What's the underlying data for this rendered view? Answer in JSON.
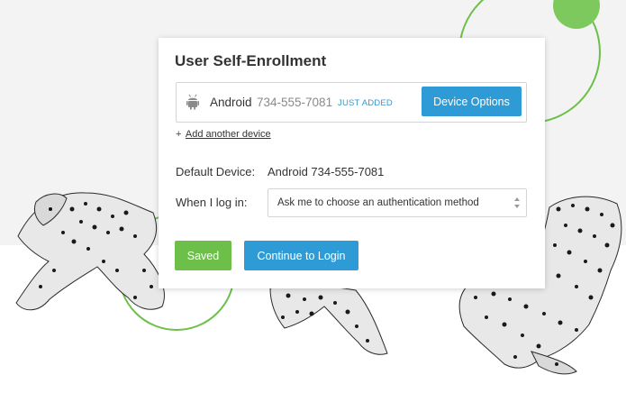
{
  "colors": {
    "accent_blue": "#2e9bd6",
    "accent_green": "#6cc04a",
    "badge_blue": "#3a96c8",
    "background_gray": "#f3f3f3"
  },
  "enrollment": {
    "title": "User Self-Enrollment",
    "device": {
      "icon": "android-icon",
      "name": "Android",
      "phone": "734-555-7081",
      "badge": "JUST ADDED",
      "options_button": "Device Options"
    },
    "add_device": {
      "plus": "+",
      "link": "Add another device"
    },
    "default_device": {
      "label": "Default Device:",
      "value": "Android 734-555-7081"
    },
    "login_method": {
      "label": "When I log in:",
      "selected": "Ask me to choose an authentication method"
    },
    "actions": {
      "saved": "Saved",
      "continue": "Continue to Login"
    }
  }
}
